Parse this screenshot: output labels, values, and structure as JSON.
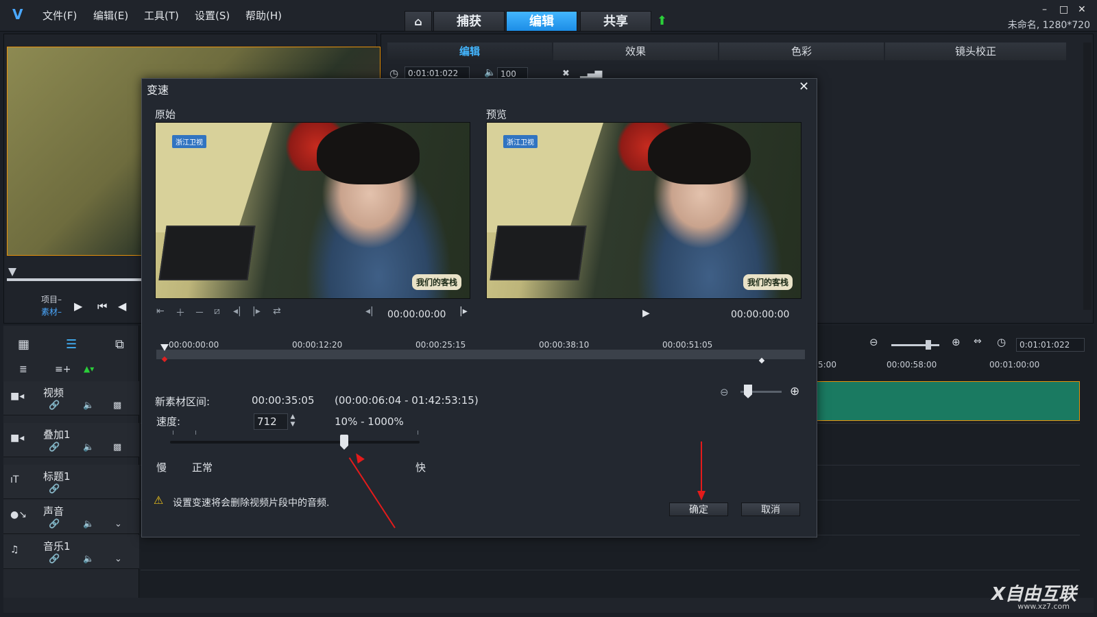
{
  "menubar": {
    "items": [
      "文件(F)",
      "编辑(E)",
      "工具(T)",
      "设置(S)",
      "帮助(H)"
    ],
    "nav_tabs": [
      "捕获",
      "编辑",
      "共享"
    ],
    "active_tab": "编辑",
    "project_info": "未命名, 1280*720",
    "window_controls": [
      "–",
      "□",
      "✕"
    ]
  },
  "left_panel": {
    "label_project": "项目–",
    "label_clip": "素材–"
  },
  "right_panel": {
    "sub_tabs": [
      "编辑",
      "效果",
      "色彩",
      "镜头校正"
    ],
    "active_sub_tab": "编辑",
    "duration": "0:01:01:022",
    "volume": "100"
  },
  "timeline": {
    "tracks": [
      {
        "name": "视频",
        "icon": "video-track-icon"
      },
      {
        "name": "叠加1",
        "icon": "overlay-track-icon"
      },
      {
        "name": "标题1",
        "icon": "title-track-icon"
      },
      {
        "name": "声音",
        "icon": "voice-track-icon"
      },
      {
        "name": "音乐1",
        "icon": "music-track-icon"
      }
    ],
    "ruler": [
      "5:00",
      "00:00:58:00",
      "00:01:00:00"
    ],
    "time": "0:01:01:022",
    "clip_color": "#1a7a61"
  },
  "dialog": {
    "title": "变速",
    "original_label": "原始",
    "preview_label": "预览",
    "original_time": "00:00:00:00",
    "preview_time": "00:00:00:00",
    "ruler_ticks": [
      "00:00:00:00",
      "00:00:12:20",
      "00:00:25:15",
      "00:00:38:10",
      "00:00:51:05"
    ],
    "new_duration_label": "新素材区间:",
    "new_duration_value": "00:00:35:05",
    "duration_range": "(00:00:06:04 - 01:42:53:15)",
    "speed_label": "速度:",
    "speed_value": "712",
    "speed_range": "10% - 1000%",
    "speed_fraction": 0.7,
    "slow_label": "慢",
    "normal_label": "正常",
    "fast_label": "快",
    "warning": "设置变速将会删除视频片段中的音频.",
    "ok_label": "确定",
    "cancel_label": "取消",
    "video_badge": "浙江卫视",
    "show_logo": "我们的客栈"
  },
  "watermark": {
    "text": "X自由互联",
    "url": "www.xz7.com"
  },
  "colors": {
    "accent": "#1c8de6",
    "arrow": "#e41b1b",
    "warning": "#f0c419"
  }
}
